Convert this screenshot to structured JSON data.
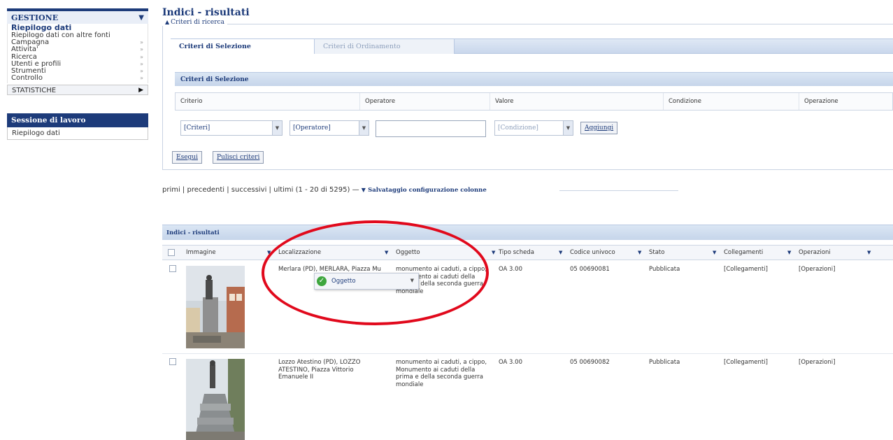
{
  "sidebar": {
    "gestione": {
      "title": "GESTIONE",
      "items": [
        {
          "label": "Riepilogo dati",
          "active": true
        },
        {
          "label": "Riepilogo dati con altre fonti",
          "active": false
        },
        {
          "label": "Campagna",
          "active": false
        },
        {
          "label": "Attivita'",
          "active": false
        },
        {
          "label": "Ricerca",
          "active": false
        },
        {
          "label": "Utenti e profili",
          "active": false
        },
        {
          "label": "Strumenti",
          "active": false
        },
        {
          "label": "Controllo",
          "active": false
        }
      ]
    },
    "statistiche": "STATISTICHE",
    "session": {
      "title": "Sessione di lavoro",
      "item": "Riepilogo dati"
    }
  },
  "page": {
    "title": "Indici - risultati",
    "criteri_legend": "Criteri di ricerca"
  },
  "tabs": {
    "selection": "Criteri di Selezione",
    "ordering": "Criteri di Ordinamento"
  },
  "selection_panel": {
    "title": "Criteri di Selezione",
    "columns": [
      "Criterio",
      "Operatore",
      "Valore",
      "Condizione",
      "Operazione"
    ]
  },
  "controls": {
    "criteri": "[Criteri]",
    "operatore": "[Operatore]",
    "valore": "",
    "condizione": "[Condizione]",
    "aggiungi": "Aggiungi",
    "esegui": "Esegui",
    "pulisci": "Pulisci criteri"
  },
  "pager": {
    "text": "primi | precedenti | successivi | ultimi (1 - 20 di 5295)",
    "save_config": "Salvataggio configurazione colonne"
  },
  "results": {
    "title": "Indici - risultati",
    "columns": [
      "Immagine",
      "Localizzazione",
      "Oggetto",
      "Tipo scheda",
      "Codice univoco",
      "Stato",
      "Collegamenti",
      "Operazioni"
    ],
    "rows": [
      {
        "localizzazione": "Merlara (PD), MERLARA, Piazza Mu",
        "oggetto": "monumento ai caduti, a cippo, Monumento ai caduti della prima e della seconda guerra mondiale",
        "tipo": "OA 3.00",
        "codice": "05 00690081",
        "stato": "Pubblicata",
        "collegamenti": "[Collegamenti]",
        "operazioni": "[Operazioni]"
      },
      {
        "localizzazione": "Lozzo Atestino (PD), LOZZO ATESTINO, Piazza Vittorio Emanuele II",
        "oggetto": "monumento ai caduti, a cippo, Monumento ai caduti della prima e della seconda guerra mondiale",
        "tipo": "OA 3.00",
        "codice": "05 00690082",
        "stato": "Pubblicata",
        "collegamenti": "[Collegamenti]",
        "operazioni": "[Operazioni]"
      }
    ]
  },
  "drag_popup": {
    "label": "Oggetto"
  },
  "colors": {
    "brand_blue": "#1d3b7a",
    "annotation_red": "#e1091c",
    "ok_green": "#3ea63e"
  }
}
